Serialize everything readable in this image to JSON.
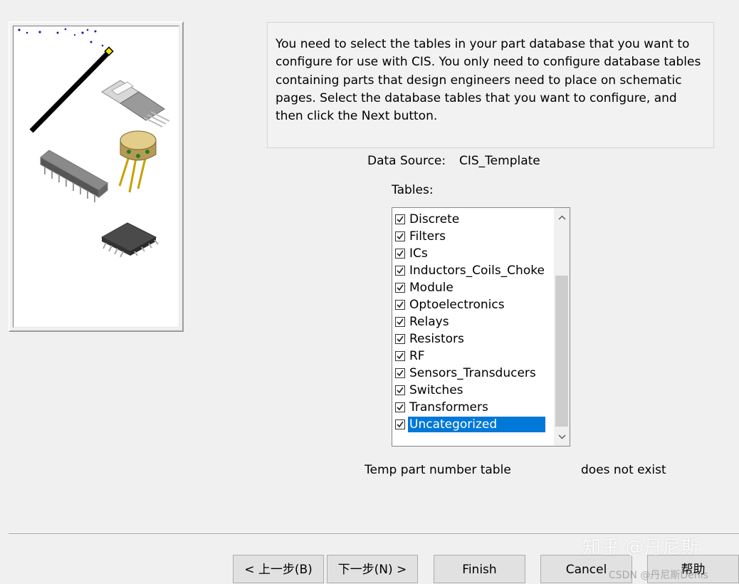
{
  "instructions": "You need to select the tables in your part database that you want to configure for use with CIS. You only need to configure database tables containing parts that design engineers need to place on schematic pages. Select the database tables that you want to configure, and then click the Next button.",
  "data_source": {
    "label": "Data Source:",
    "value": "CIS_Template"
  },
  "tables_label": "Tables:",
  "tables": [
    {
      "label": "Discrete",
      "checked": true
    },
    {
      "label": "Filters",
      "checked": true
    },
    {
      "label": "ICs",
      "checked": true
    },
    {
      "label": "Inductors_Coils_Choke",
      "checked": true
    },
    {
      "label": "Module",
      "checked": true
    },
    {
      "label": "Optoelectronics",
      "checked": true
    },
    {
      "label": "Relays",
      "checked": true
    },
    {
      "label": "Resistors",
      "checked": true
    },
    {
      "label": "RF",
      "checked": true
    },
    {
      "label": "Sensors_Transducers",
      "checked": true
    },
    {
      "label": "Switches",
      "checked": true
    },
    {
      "label": "Transformers",
      "checked": true
    },
    {
      "label": "Uncategorized",
      "checked": true,
      "selected": true
    }
  ],
  "temp_table": {
    "label": "Temp part number table",
    "status": "does not exist"
  },
  "buttons": {
    "back": "< 上一步(B)",
    "next": "下一步(N) >",
    "finish": "Finish",
    "cancel": "Cancel",
    "help": "帮助"
  },
  "watermark": {
    "main": "知乎 @丹尼斯",
    "small": "CSDN @丹尼斯Denis"
  },
  "colors": {
    "selection": "#0078d7",
    "background": "#f0f0f0"
  }
}
